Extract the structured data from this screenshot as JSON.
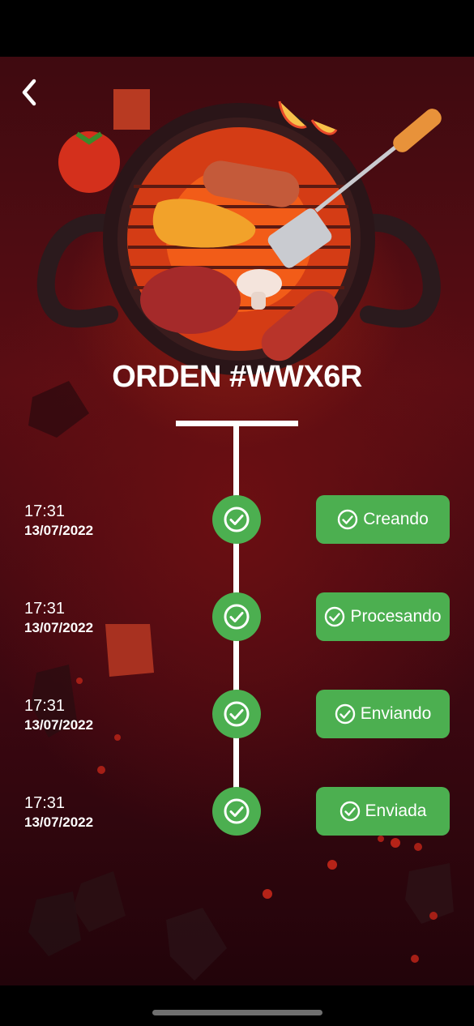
{
  "header": {
    "back_icon": "chevron-left-icon",
    "illustration": "grill-illustration"
  },
  "order": {
    "title": "ORDEN #WWX6R"
  },
  "timeline": {
    "accent_color": "#4caf50",
    "steps": [
      {
        "time": "17:31",
        "date": "13/07/2022",
        "status": "Creando",
        "icon": "check-circle-icon"
      },
      {
        "time": "17:31",
        "date": "13/07/2022",
        "status": "Procesando",
        "icon": "check-circle-icon"
      },
      {
        "time": "17:31",
        "date": "13/07/2022",
        "status": "Enviando",
        "icon": "check-circle-icon"
      },
      {
        "time": "17:31",
        "date": "13/07/2022",
        "status": "Enviada",
        "icon": "check-circle-icon"
      }
    ]
  }
}
